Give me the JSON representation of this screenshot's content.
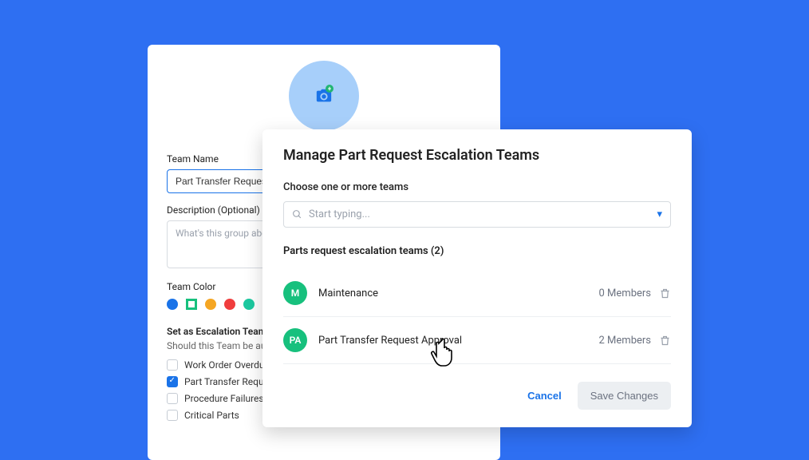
{
  "form": {
    "teamNameLabel": "Team Name",
    "teamNameValue": "Part Transfer Request Approval",
    "descLabel": "Description (Optional)",
    "descPlaceholder": "What's this group about?",
    "colorLabel": "Team Color",
    "colors": [
      "#1a73e8",
      "#17c07d",
      "#f5a623",
      "#f03d3d",
      "#1dc9a0",
      "#ff3f7f"
    ],
    "escTitle": "Set as Escalation Team",
    "escSub": "Should this Team be automatically",
    "checks": [
      {
        "label": "Work Order Overdue",
        "checked": false
      },
      {
        "label": "Part Transfer Request",
        "checked": true
      },
      {
        "label": "Procedure Failures & Flags",
        "checked": false
      },
      {
        "label": "Critical Parts",
        "checked": false
      }
    ]
  },
  "modal": {
    "title": "Manage Part Request Escalation Teams",
    "chooseLabel": "Choose one or more teams",
    "searchPlaceholder": "Start typing...",
    "listTitle": "Parts request escalation teams (2)",
    "teams": [
      {
        "initials": "M",
        "name": "Maintenance",
        "members": "0 Members"
      },
      {
        "initials": "PA",
        "name": "Part Transfer Request Approval",
        "members": "2 Members"
      }
    ],
    "cancel": "Cancel",
    "save": "Save Changes"
  }
}
